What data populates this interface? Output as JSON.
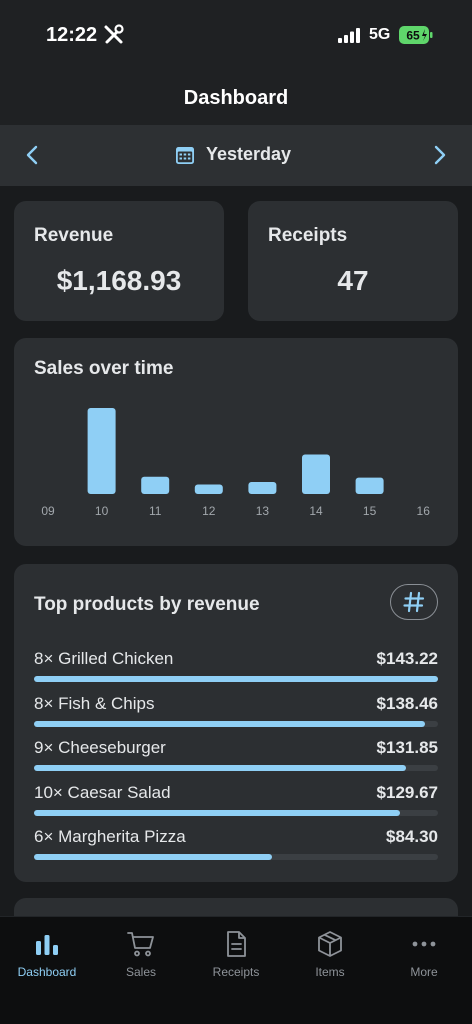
{
  "status_bar": {
    "time": "12:22",
    "network": "5G",
    "battery": "65"
  },
  "nav": {
    "title": "Dashboard"
  },
  "date_selector": {
    "label": "Yesterday"
  },
  "stats": [
    {
      "title": "Revenue",
      "value": "$1,168.93"
    },
    {
      "title": "Receipts",
      "value": "47"
    }
  ],
  "sales_chart": {
    "title": "Sales over time",
    "chart_data": {
      "type": "bar",
      "categories": [
        "09",
        "10",
        "11",
        "12",
        "13",
        "14",
        "15",
        "16"
      ],
      "values": [
        0,
        100,
        20,
        11,
        14,
        46,
        19,
        0
      ],
      "bar_color": "#8fcff5"
    }
  },
  "top_products": {
    "title": "Top products by revenue",
    "max_value": 143.22,
    "items": [
      {
        "name": "8× Grilled Chicken",
        "amount": "$143.22",
        "value": 143.22
      },
      {
        "name": "8× Fish & Chips",
        "amount": "$138.46",
        "value": 138.46
      },
      {
        "name": "9× Cheeseburger",
        "amount": "$131.85",
        "value": 131.85
      },
      {
        "name": "10× Caesar Salad",
        "amount": "$129.67",
        "value": 129.67
      },
      {
        "name": "6× Margherita Pizza",
        "amount": "$84.30",
        "value": 84.3
      }
    ]
  },
  "tabs": [
    {
      "label": "Dashboard",
      "icon": "bar-chart-icon",
      "active": true
    },
    {
      "label": "Sales",
      "icon": "cart-icon",
      "active": false
    },
    {
      "label": "Receipts",
      "icon": "document-icon",
      "active": false
    },
    {
      "label": "Items",
      "icon": "box-icon",
      "active": false
    },
    {
      "label": "More",
      "icon": "more-icon",
      "active": false
    }
  ],
  "colors": {
    "accent": "#8fcff5",
    "background": "#191b1d",
    "card": "#2c2f32"
  }
}
